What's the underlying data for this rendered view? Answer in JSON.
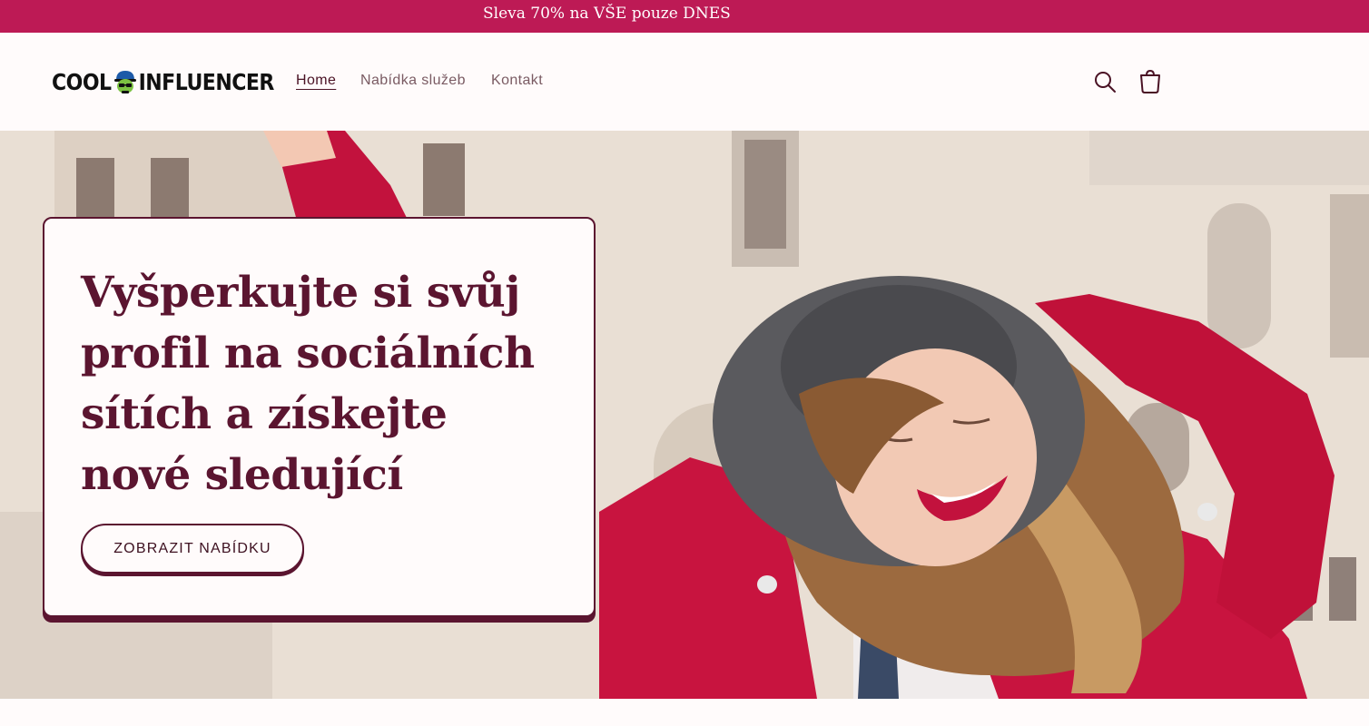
{
  "announcement": {
    "text": "Sleva 70% na VŠE pouze DNES"
  },
  "header": {
    "logo_text_left": "COOL",
    "logo_text_right": "INFLUENCER",
    "nav": [
      {
        "label": "Home",
        "active": true
      },
      {
        "label": "Nabídka služeb",
        "active": false
      },
      {
        "label": "Kontakt",
        "active": false
      }
    ],
    "icons": [
      "search-icon",
      "cart-icon"
    ]
  },
  "hero": {
    "title": "Vyšperkujte si svůj profil na sociálních sítích a získejte nové sledující",
    "button_label": "ZOBRAZIT NABÍDKU"
  },
  "colors": {
    "announcement_bg": "#bd1a55",
    "brand_dark": "#5b1530",
    "page_bg": "#fffbfb"
  }
}
